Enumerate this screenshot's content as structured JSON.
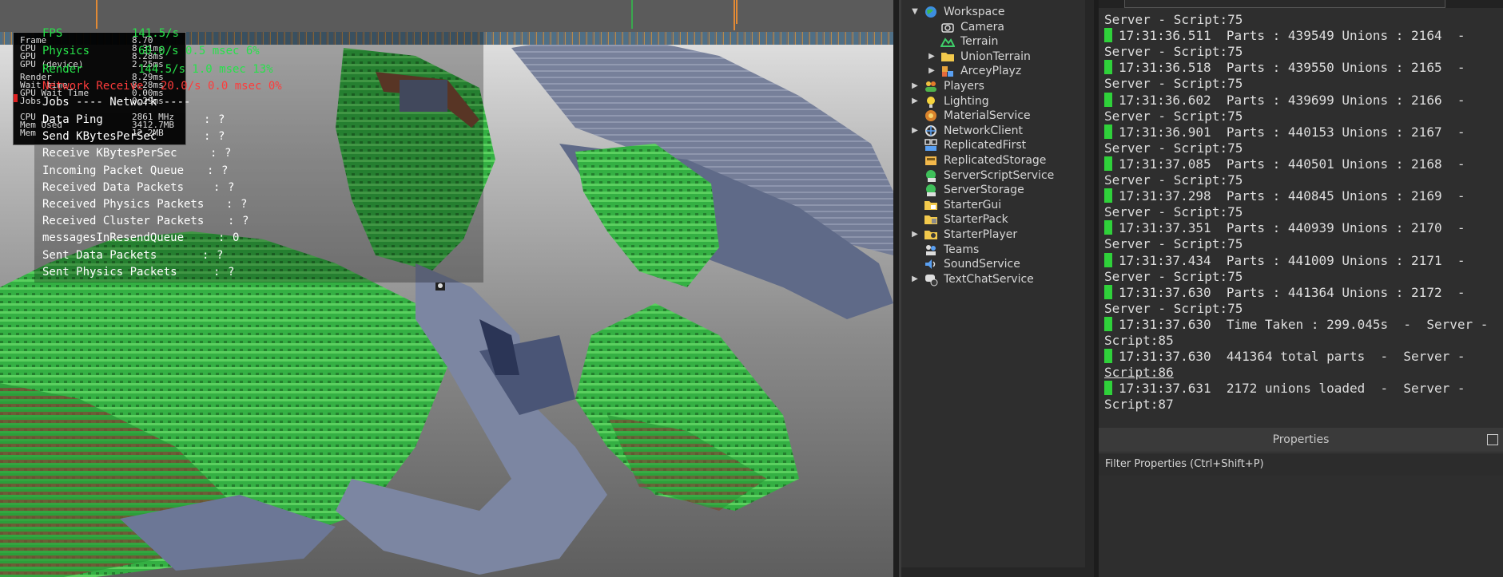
{
  "colors": {
    "terrain_green": "#2fa63c",
    "terrain_brown": "#7a5138",
    "slate": "#6b7591",
    "stat_green": "#27e24a",
    "stat_red": "#ff3b3b",
    "log_marker": "#2fd13a"
  },
  "viewport": {
    "stats_panel": [
      {
        "label": "Frame",
        "value": "8.70"
      },
      {
        "label": "CPU",
        "value": "8.31ms"
      },
      {
        "label": "GPU",
        "value": "8.28ms"
      },
      {
        "label": "GPU (device)",
        "value": "2.25ms"
      },
      {
        "label": "Render",
        "value": "8.29ms"
      },
      {
        "label": "Wait time",
        "value": "8.28ms"
      },
      {
        "label": "GPU Wait Time",
        "value": "0.00ms"
      },
      {
        "label": "Jobs",
        "value": "0.29ms"
      },
      {
        "label": "CPU",
        "value": "2861 MHz"
      },
      {
        "label": "Mem Used",
        "value": "3412.7MB"
      },
      {
        "label": "Mem",
        "value": "12.2MB"
      }
    ],
    "overlay_green": [
      {
        "label": "FPS",
        "value": "141.5/s"
      },
      {
        "label": "Physics",
        "value": "60.0/s 0.5 msec 6%"
      },
      {
        "label": "Render",
        "value": "144.5/s 1.0 msec 13%"
      }
    ],
    "overlay_red": {
      "label": "Network Receive",
      "value": "20.0/s 0.0 msec 0%"
    },
    "network_header": "Network",
    "network_rows": [
      {
        "label": "Data Ping",
        "value": "?"
      },
      {
        "label": "Send KBytesPerSec",
        "value": "?"
      },
      {
        "label": "Receive KBytesPerSec",
        "value": "?"
      },
      {
        "label": "Incoming Packet Queue",
        "value": "?"
      },
      {
        "label": "Received Data Packets",
        "value": "?"
      },
      {
        "label": "Received Physics Packets",
        "value": "?"
      },
      {
        "label": "Received Cluster Packets",
        "value": "?"
      },
      {
        "label": "messagesInResendQueue",
        "value": "0"
      },
      {
        "label": "Sent Data Packets",
        "value": "?"
      },
      {
        "label": "Sent Physics Packets",
        "value": "?"
      }
    ]
  },
  "explorer": {
    "items": [
      {
        "label": "Workspace",
        "icon": "globe-icon",
        "arrow": "expanded"
      },
      {
        "label": "Camera",
        "icon": "camera-icon",
        "arrow": "none"
      },
      {
        "label": "Terrain",
        "icon": "terrain-icon",
        "arrow": "none"
      },
      {
        "label": "UnionTerrain",
        "icon": "folder-icon",
        "arrow": "collapsed"
      },
      {
        "label": "ArceyPlayz",
        "icon": "model-icon",
        "arrow": "collapsed"
      },
      {
        "label": "Players",
        "icon": "players-icon",
        "arrow": "collapsed"
      },
      {
        "label": "Lighting",
        "icon": "lightbulb-icon",
        "arrow": "collapsed"
      },
      {
        "label": "MaterialService",
        "icon": "material-icon",
        "arrow": "none"
      },
      {
        "label": "NetworkClient",
        "icon": "network-icon",
        "arrow": "collapsed"
      },
      {
        "label": "ReplicatedFirst",
        "icon": "replicated-first-icon",
        "arrow": "none"
      },
      {
        "label": "ReplicatedStorage",
        "icon": "replicated-storage-icon",
        "arrow": "none"
      },
      {
        "label": "ServerScriptService",
        "icon": "server-script-icon",
        "arrow": "none"
      },
      {
        "label": "ServerStorage",
        "icon": "server-storage-icon",
        "arrow": "none"
      },
      {
        "label": "StarterGui",
        "icon": "starter-gui-icon",
        "arrow": "none"
      },
      {
        "label": "StarterPack",
        "icon": "starter-pack-icon",
        "arrow": "none"
      },
      {
        "label": "StarterPlayer",
        "icon": "starter-player-icon",
        "arrow": "collapsed"
      },
      {
        "label": "Teams",
        "icon": "teams-icon",
        "arrow": "none"
      },
      {
        "label": "SoundService",
        "icon": "sound-icon",
        "arrow": "none"
      },
      {
        "label": "TextChatService",
        "icon": "chat-icon",
        "arrow": "collapsed"
      }
    ]
  },
  "output": {
    "lines": [
      {
        "text": "Server - Script:75",
        "marker": false
      },
      {
        "text": "17:31:36.511  Parts : 439549 Unions : 2164  -",
        "marker": true
      },
      {
        "text": "Server - Script:75",
        "marker": false
      },
      {
        "text": "17:31:36.518  Parts : 439550 Unions : 2165  -",
        "marker": true
      },
      {
        "text": "Server - Script:75",
        "marker": false
      },
      {
        "text": "17:31:36.602  Parts : 439699 Unions : 2166  -",
        "marker": true
      },
      {
        "text": "Server - Script:75",
        "marker": false
      },
      {
        "text": "17:31:36.901  Parts : 440153 Unions : 2167  -",
        "marker": true
      },
      {
        "text": "Server - Script:75",
        "marker": false
      },
      {
        "text": "17:31:37.085  Parts : 440501 Unions : 2168  -",
        "marker": true
      },
      {
        "text": "Server - Script:75",
        "marker": false
      },
      {
        "text": "17:31:37.298  Parts : 440845 Unions : 2169  -",
        "marker": true
      },
      {
        "text": "Server - Script:75",
        "marker": false
      },
      {
        "text": "17:31:37.351  Parts : 440939 Unions : 2170  -",
        "marker": true
      },
      {
        "text": "Server - Script:75",
        "marker": false
      },
      {
        "text": "17:31:37.434  Parts : 441009 Unions : 2171  -",
        "marker": true
      },
      {
        "text": "Server - Script:75",
        "marker": false
      },
      {
        "text": "17:31:37.630  Parts : 441364 Unions : 2172  -",
        "marker": true
      },
      {
        "text": "Server - Script:75",
        "marker": false
      },
      {
        "text": "17:31:37.630  Time Taken : 299.045s  -  Server -",
        "marker": true
      },
      {
        "text": "Script:85",
        "marker": false
      },
      {
        "text": "17:31:37.630  441364 total parts  -  Server -",
        "marker": true
      },
      {
        "text": "Script:86",
        "marker": false,
        "underline": true
      },
      {
        "text": "17:31:37.631  2172 unions loaded  -  Server -",
        "marker": true
      },
      {
        "text": "Script:87",
        "marker": false
      }
    ]
  },
  "properties": {
    "title": "Properties",
    "filter_placeholder": "Filter Properties (Ctrl+Shift+P)"
  }
}
